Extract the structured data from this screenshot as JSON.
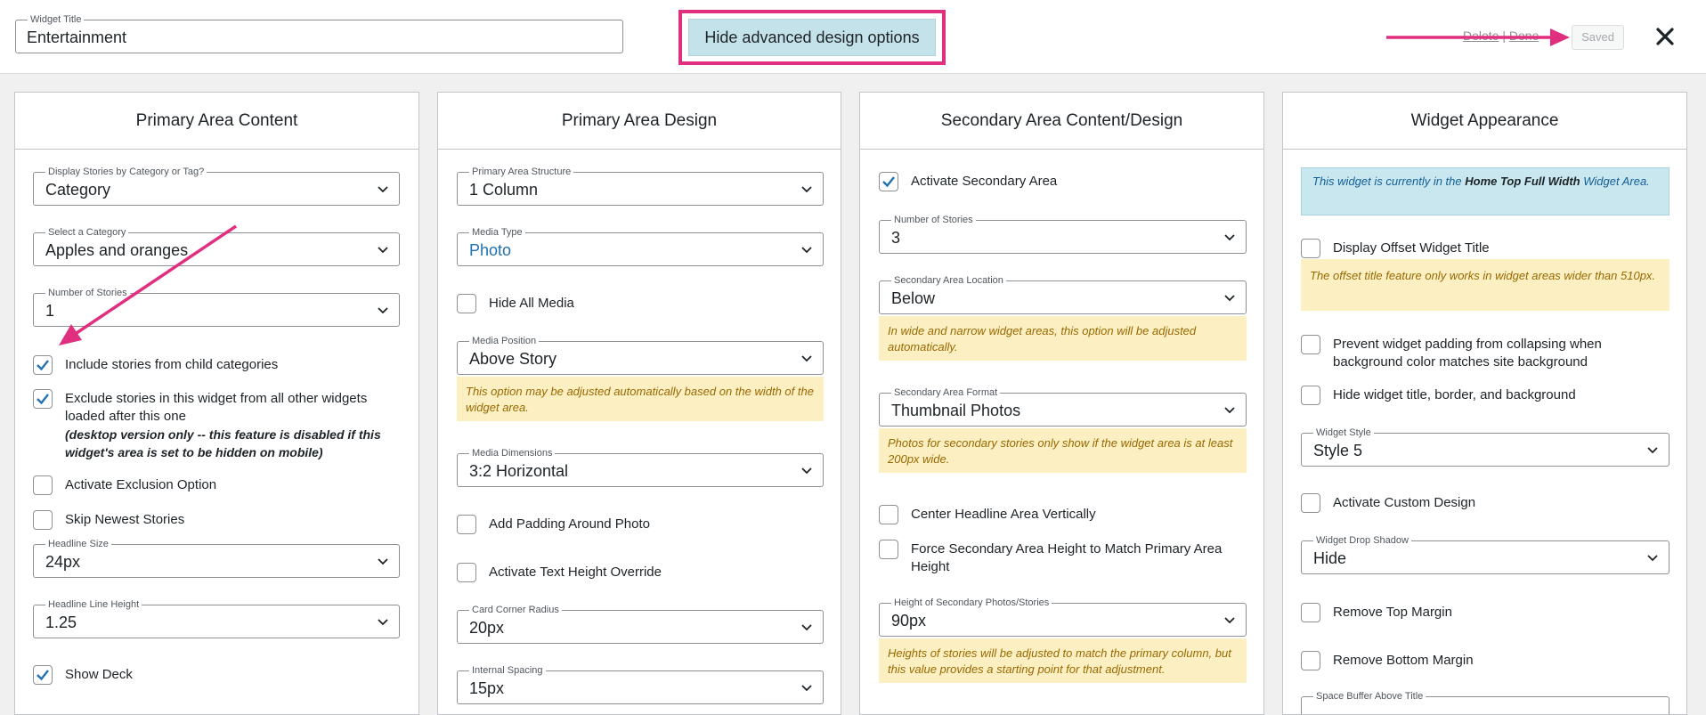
{
  "header": {
    "widget_title_label": "Widget Title",
    "widget_title_value": "Entertainment",
    "advanced_button": "Hide advanced design options",
    "delete_label": "Delete",
    "separator": "|",
    "done_label": "Done",
    "saved_label": "Saved"
  },
  "primary_content": {
    "title": "Primary Area Content",
    "display_by": {
      "label": "Display Stories by Category or Tag?",
      "value": "Category"
    },
    "category": {
      "label": "Select a Category",
      "value": "Apples and oranges"
    },
    "num_stories": {
      "label": "Number of Stories",
      "value": "1"
    },
    "include_children": "Include stories from child categories",
    "exclude_line1": "Exclude stories in this widget from all other widgets loaded after this one",
    "exclude_note": "(desktop version only -- this feature is disabled if this widget's area is set to be hidden on mobile)",
    "activate_exclusion": "Activate Exclusion Option",
    "skip_newest": "Skip Newest Stories",
    "headline_size": {
      "label": "Headline Size",
      "value": "24px"
    },
    "headline_line_height": {
      "label": "Headline Line Height",
      "value": "1.25"
    },
    "show_deck": "Show Deck"
  },
  "primary_design": {
    "title": "Primary Area Design",
    "structure": {
      "label": "Primary Area Structure",
      "value": "1 Column"
    },
    "media_type": {
      "label": "Media Type",
      "value": "Photo"
    },
    "hide_all_media": "Hide All Media",
    "media_position": {
      "label": "Media Position",
      "value": "Above Story"
    },
    "media_position_note": "This option may be adjusted automatically based on the width of the widget area.",
    "media_dimensions": {
      "label": "Media Dimensions",
      "value": "3:2 Horizontal"
    },
    "add_padding": "Add Padding Around Photo",
    "text_height_override": "Activate Text Height Override",
    "corner_radius": {
      "label": "Card Corner Radius",
      "value": "20px"
    },
    "internal_spacing": {
      "label": "Internal Spacing",
      "value": "15px"
    }
  },
  "secondary": {
    "title": "Secondary Area Content/Design",
    "activate_secondary": "Activate Secondary Area",
    "num_stories": {
      "label": "Number of Stories",
      "value": "3"
    },
    "location": {
      "label": "Secondary Area Location",
      "value": "Below"
    },
    "location_note": "In wide and narrow widget areas, this option will be adjusted automatically.",
    "format": {
      "label": "Secondary Area Format",
      "value": "Thumbnail Photos"
    },
    "format_note": "Photos for secondary stories only show if the widget area is at least 200px wide.",
    "center_headline": "Center Headline Area Vertically",
    "force_height": "Force Secondary Area Height to Match Primary Area Height",
    "photo_height": {
      "label": "Height of Secondary Photos/Stories",
      "value": "90px"
    },
    "photo_height_note": "Heights of stories will be adjusted to match the primary column, but this value provides a starting point for that adjustment."
  },
  "appearance": {
    "title": "Widget Appearance",
    "info_pre": "This widget is currently in the ",
    "info_area": "Home Top Full Width",
    "info_post": " Widget Area.",
    "display_offset": "Display Offset Widget Title",
    "offset_note": "The offset title feature only works in widget areas wider than 510px.",
    "prevent_padding": "Prevent widget padding from collapsing when background color matches site background",
    "hide_title": "Hide widget title, border, and background",
    "style": {
      "label": "Widget Style",
      "value": "Style 5"
    },
    "custom_design": "Activate Custom Design",
    "drop_shadow": {
      "label": "Widget Drop Shadow",
      "value": "Hide"
    },
    "remove_top": "Remove Top Margin",
    "remove_bottom": "Remove Bottom Margin",
    "space_buffer": "Space Buffer Above Title"
  },
  "colors": {
    "accent": "#e02f7f",
    "check": "#2271b1"
  }
}
